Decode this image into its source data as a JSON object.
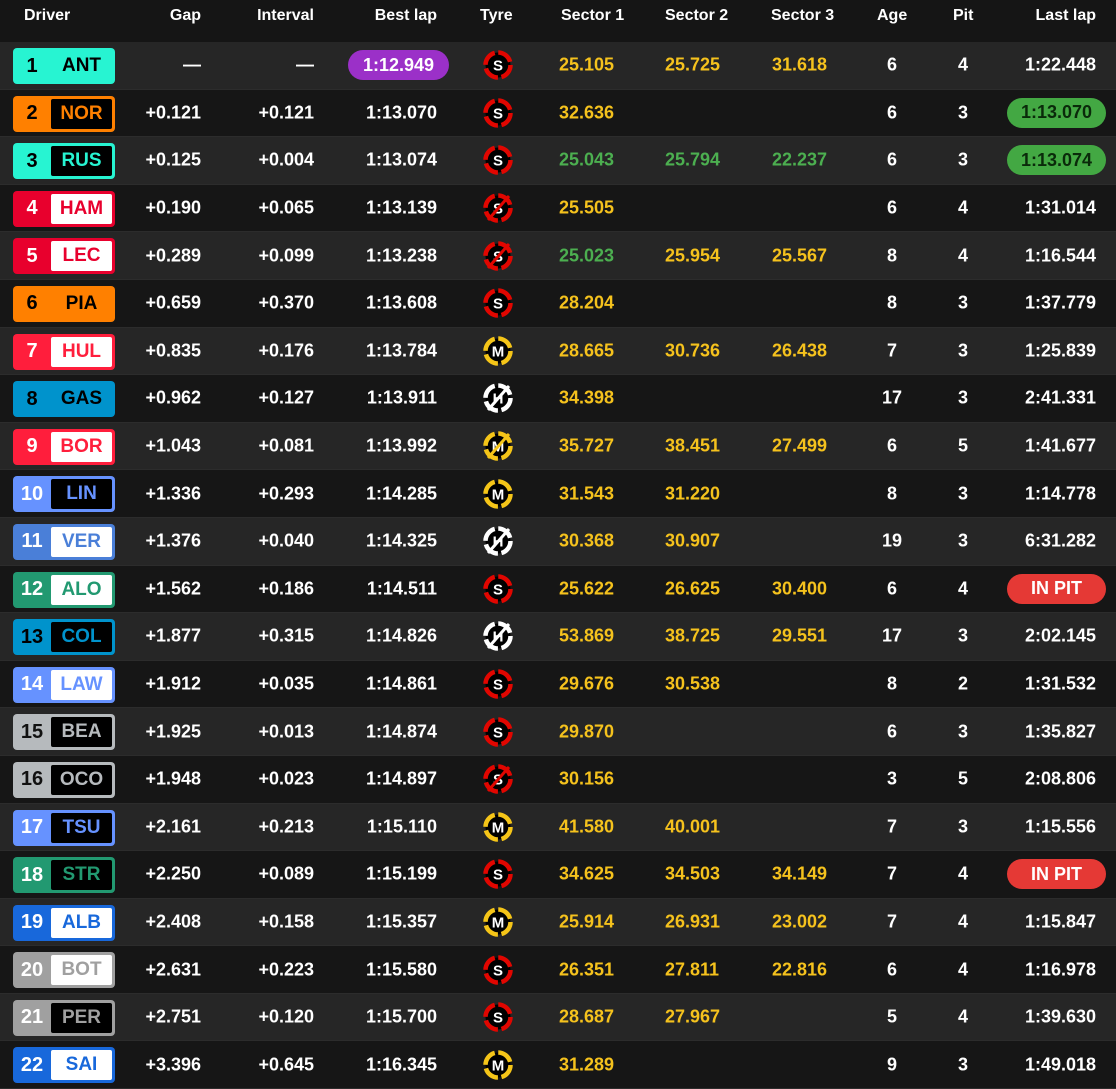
{
  "headers": {
    "driver": "Driver",
    "gap": "Gap",
    "interval": "Interval",
    "best_lap": "Best lap",
    "tyre": "Tyre",
    "sector1": "Sector 1",
    "sector2": "Sector 2",
    "sector3": "Sector 3",
    "age": "Age",
    "pit": "Pit",
    "last_lap": "Last lap"
  },
  "colors": {
    "sector_yellow": "#f5c21d",
    "sector_green": "#4caf50",
    "best_purple": "#9b30c8",
    "pill_green": "#43a843",
    "pill_red": "#e53935",
    "soft": "#e10600",
    "medium": "#f5c518",
    "hard": "#ffffff"
  },
  "rows": [
    {
      "pos": "1",
      "code": "ANT",
      "team_color": "#27f4d2",
      "code_bg": "#27f4d2",
      "code_fg": "#000000",
      "gap": "—",
      "interval": "—",
      "best": "1:12.949",
      "best_highlight": "purple",
      "tyre": "S",
      "tyre_icon": "soft-tyre-icon",
      "tyre_used": false,
      "s1": "25.105",
      "s1c": "yellow",
      "s2": "25.725",
      "s2c": "yellow",
      "s3": "31.618",
      "s3c": "yellow",
      "age": "6",
      "pit": "4",
      "last": "1:22.448",
      "last_style": "plain"
    },
    {
      "pos": "2",
      "code": "NOR",
      "team_color": "#ff8000",
      "code_bg": "#000000",
      "code_fg": "#ff8000",
      "gap": "+0.121",
      "interval": "+0.121",
      "best": "1:13.070",
      "best_highlight": "",
      "tyre": "S",
      "tyre_icon": "soft-tyre-icon",
      "tyre_used": false,
      "s1": "32.636",
      "s1c": "yellow",
      "s2": "",
      "s2c": "",
      "s3": "",
      "s3c": "",
      "age": "6",
      "pit": "3",
      "last": "1:13.070",
      "last_style": "green"
    },
    {
      "pos": "3",
      "code": "RUS",
      "team_color": "#27f4d2",
      "code_bg": "#000000",
      "code_fg": "#27f4d2",
      "gap": "+0.125",
      "interval": "+0.004",
      "best": "1:13.074",
      "best_highlight": "",
      "tyre": "S",
      "tyre_icon": "soft-tyre-icon",
      "tyre_used": false,
      "s1": "25.043",
      "s1c": "green",
      "s2": "25.794",
      "s2c": "green",
      "s3": "22.237",
      "s3c": "green",
      "age": "6",
      "pit": "3",
      "last": "1:13.074",
      "last_style": "green"
    },
    {
      "pos": "4",
      "code": "HAM",
      "team_color": "#e8002d",
      "code_bg": "#ffffff",
      "code_fg": "#e8002d",
      "gap": "+0.190",
      "interval": "+0.065",
      "best": "1:13.139",
      "best_highlight": "",
      "tyre": "S",
      "tyre_icon": "soft-tyre-icon",
      "tyre_used": true,
      "s1": "25.505",
      "s1c": "yellow",
      "s2": "",
      "s2c": "",
      "s3": "",
      "s3c": "",
      "age": "6",
      "pit": "4",
      "last": "1:31.014",
      "last_style": "plain"
    },
    {
      "pos": "5",
      "code": "LEC",
      "team_color": "#e8002d",
      "code_bg": "#ffffff",
      "code_fg": "#e8002d",
      "gap": "+0.289",
      "interval": "+0.099",
      "best": "1:13.238",
      "best_highlight": "",
      "tyre": "S",
      "tyre_icon": "soft-tyre-icon",
      "tyre_used": true,
      "s1": "25.023",
      "s1c": "green",
      "s2": "25.954",
      "s2c": "yellow",
      "s3": "25.567",
      "s3c": "yellow",
      "age": "8",
      "pit": "4",
      "last": "1:16.544",
      "last_style": "plain"
    },
    {
      "pos": "6",
      "code": "PIA",
      "team_color": "#ff8000",
      "code_bg": "#ff8000",
      "code_fg": "#000000",
      "gap": "+0.659",
      "interval": "+0.370",
      "best": "1:13.608",
      "best_highlight": "",
      "tyre": "S",
      "tyre_icon": "soft-tyre-icon",
      "tyre_used": false,
      "s1": "28.204",
      "s1c": "yellow",
      "s2": "",
      "s2c": "",
      "s3": "",
      "s3c": "",
      "age": "8",
      "pit": "3",
      "last": "1:37.779",
      "last_style": "plain"
    },
    {
      "pos": "7",
      "code": "HUL",
      "team_color": "#ff1e3c",
      "code_bg": "#ffffff",
      "code_fg": "#ff1e3c",
      "gap": "+0.835",
      "interval": "+0.176",
      "best": "1:13.784",
      "best_highlight": "",
      "tyre": "M",
      "tyre_icon": "medium-tyre-icon",
      "tyre_used": false,
      "s1": "28.665",
      "s1c": "yellow",
      "s2": "30.736",
      "s2c": "yellow",
      "s3": "26.438",
      "s3c": "yellow",
      "age": "7",
      "pit": "3",
      "last": "1:25.839",
      "last_style": "plain"
    },
    {
      "pos": "8",
      "code": "GAS",
      "team_color": "#0093cc",
      "code_bg": "#0093cc",
      "code_fg": "#000000",
      "gap": "+0.962",
      "interval": "+0.127",
      "best": "1:13.911",
      "best_highlight": "",
      "tyre": "H",
      "tyre_icon": "hard-tyre-icon",
      "tyre_used": true,
      "s1": "34.398",
      "s1c": "yellow",
      "s2": "",
      "s2c": "",
      "s3": "",
      "s3c": "",
      "age": "17",
      "pit": "3",
      "last": "2:41.331",
      "last_style": "plain"
    },
    {
      "pos": "9",
      "code": "BOR",
      "team_color": "#ff1e3c",
      "code_bg": "#ffffff",
      "code_fg": "#ff1e3c",
      "gap": "+1.043",
      "interval": "+0.081",
      "best": "1:13.992",
      "best_highlight": "",
      "tyre": "M",
      "tyre_icon": "medium-tyre-icon",
      "tyre_used": true,
      "s1": "35.727",
      "s1c": "yellow",
      "s2": "38.451",
      "s2c": "yellow",
      "s3": "27.499",
      "s3c": "yellow",
      "age": "6",
      "pit": "5",
      "last": "1:41.677",
      "last_style": "plain"
    },
    {
      "pos": "10",
      "code": "LIN",
      "team_color": "#6692ff",
      "code_bg": "#000000",
      "code_fg": "#6692ff",
      "gap": "+1.336",
      "interval": "+0.293",
      "best": "1:14.285",
      "best_highlight": "",
      "tyre": "M",
      "tyre_icon": "medium-tyre-icon",
      "tyre_used": false,
      "s1": "31.543",
      "s1c": "yellow",
      "s2": "31.220",
      "s2c": "yellow",
      "s3": "",
      "s3c": "",
      "age": "8",
      "pit": "3",
      "last": "1:14.778",
      "last_style": "plain"
    },
    {
      "pos": "11",
      "code": "VER",
      "team_color": "#4a7fd8",
      "code_bg": "#ffffff",
      "code_fg": "#4a7fd8",
      "gap": "+1.376",
      "interval": "+0.040",
      "best": "1:14.325",
      "best_highlight": "",
      "tyre": "H",
      "tyre_icon": "hard-tyre-icon",
      "tyre_used": true,
      "s1": "30.368",
      "s1c": "yellow",
      "s2": "30.907",
      "s2c": "yellow",
      "s3": "",
      "s3c": "",
      "age": "19",
      "pit": "3",
      "last": "6:31.282",
      "last_style": "plain"
    },
    {
      "pos": "12",
      "code": "ALO",
      "team_color": "#229971",
      "code_bg": "#ffffff",
      "code_fg": "#229971",
      "gap": "+1.562",
      "interval": "+0.186",
      "best": "1:14.511",
      "best_highlight": "",
      "tyre": "S",
      "tyre_icon": "soft-tyre-icon",
      "tyre_used": false,
      "s1": "25.622",
      "s1c": "yellow",
      "s2": "26.625",
      "s2c": "yellow",
      "s3": "30.400",
      "s3c": "yellow",
      "age": "6",
      "pit": "4",
      "last": "IN PIT",
      "last_style": "red"
    },
    {
      "pos": "13",
      "code": "COL",
      "team_color": "#0093cc",
      "code_bg": "#000000",
      "code_fg": "#0093cc",
      "gap": "+1.877",
      "interval": "+0.315",
      "best": "1:14.826",
      "best_highlight": "",
      "tyre": "H",
      "tyre_icon": "hard-tyre-icon",
      "tyre_used": true,
      "s1": "53.869",
      "s1c": "yellow",
      "s2": "38.725",
      "s2c": "yellow",
      "s3": "29.551",
      "s3c": "yellow",
      "age": "17",
      "pit": "3",
      "last": "2:02.145",
      "last_style": "plain"
    },
    {
      "pos": "14",
      "code": "LAW",
      "team_color": "#6692ff",
      "code_bg": "#ffffff",
      "code_fg": "#6692ff",
      "gap": "+1.912",
      "interval": "+0.035",
      "best": "1:14.861",
      "best_highlight": "",
      "tyre": "S",
      "tyre_icon": "soft-tyre-icon",
      "tyre_used": false,
      "s1": "29.676",
      "s1c": "yellow",
      "s2": "30.538",
      "s2c": "yellow",
      "s3": "",
      "s3c": "",
      "age": "8",
      "pit": "2",
      "last": "1:31.532",
      "last_style": "plain"
    },
    {
      "pos": "15",
      "code": "BEA",
      "team_color": "#b6babd",
      "code_bg": "#000000",
      "code_fg": "#b6babd",
      "gap": "+1.925",
      "interval": "+0.013",
      "best": "1:14.874",
      "best_highlight": "",
      "tyre": "S",
      "tyre_icon": "soft-tyre-icon",
      "tyre_used": false,
      "s1": "29.870",
      "s1c": "yellow",
      "s2": "",
      "s2c": "",
      "s3": "",
      "s3c": "",
      "age": "6",
      "pit": "3",
      "last": "1:35.827",
      "last_style": "plain"
    },
    {
      "pos": "16",
      "code": "OCO",
      "team_color": "#b6babd",
      "code_bg": "#000000",
      "code_fg": "#b6babd",
      "gap": "+1.948",
      "interval": "+0.023",
      "best": "1:14.897",
      "best_highlight": "",
      "tyre": "S",
      "tyre_icon": "soft-tyre-icon",
      "tyre_used": true,
      "s1": "30.156",
      "s1c": "yellow",
      "s2": "",
      "s2c": "",
      "s3": "",
      "s3c": "",
      "age": "3",
      "pit": "5",
      "last": "2:08.806",
      "last_style": "plain"
    },
    {
      "pos": "17",
      "code": "TSU",
      "team_color": "#6692ff",
      "code_bg": "#000000",
      "code_fg": "#6692ff",
      "gap": "+2.161",
      "interval": "+0.213",
      "best": "1:15.110",
      "best_highlight": "",
      "tyre": "M",
      "tyre_icon": "medium-tyre-icon",
      "tyre_used": false,
      "s1": "41.580",
      "s1c": "yellow",
      "s2": "40.001",
      "s2c": "yellow",
      "s3": "",
      "s3c": "",
      "age": "7",
      "pit": "3",
      "last": "1:15.556",
      "last_style": "plain"
    },
    {
      "pos": "18",
      "code": "STR",
      "team_color": "#229971",
      "code_bg": "#000000",
      "code_fg": "#229971",
      "gap": "+2.250",
      "interval": "+0.089",
      "best": "1:15.199",
      "best_highlight": "",
      "tyre": "S",
      "tyre_icon": "soft-tyre-icon",
      "tyre_used": false,
      "s1": "34.625",
      "s1c": "yellow",
      "s2": "34.503",
      "s2c": "yellow",
      "s3": "34.149",
      "s3c": "yellow",
      "age": "7",
      "pit": "4",
      "last": "IN PIT",
      "last_style": "red"
    },
    {
      "pos": "19",
      "code": "ALB",
      "team_color": "#1868db",
      "code_bg": "#ffffff",
      "code_fg": "#1868db",
      "gap": "+2.408",
      "interval": "+0.158",
      "best": "1:15.357",
      "best_highlight": "",
      "tyre": "M",
      "tyre_icon": "medium-tyre-icon",
      "tyre_used": false,
      "s1": "25.914",
      "s1c": "yellow",
      "s2": "26.931",
      "s2c": "yellow",
      "s3": "23.002",
      "s3c": "yellow",
      "age": "7",
      "pit": "4",
      "last": "1:15.847",
      "last_style": "plain"
    },
    {
      "pos": "20",
      "code": "BOT",
      "team_color": "#a0a0a0",
      "code_bg": "#ffffff",
      "code_fg": "#a0a0a0",
      "gap": "+2.631",
      "interval": "+0.223",
      "best": "1:15.580",
      "best_highlight": "",
      "tyre": "S",
      "tyre_icon": "soft-tyre-icon",
      "tyre_used": false,
      "s1": "26.351",
      "s1c": "yellow",
      "s2": "27.811",
      "s2c": "yellow",
      "s3": "22.816",
      "s3c": "yellow",
      "age": "6",
      "pit": "4",
      "last": "1:16.978",
      "last_style": "plain"
    },
    {
      "pos": "21",
      "code": "PER",
      "team_color": "#a0a0a0",
      "code_bg": "#000000",
      "code_fg": "#a0a0a0",
      "gap": "+2.751",
      "interval": "+0.120",
      "best": "1:15.700",
      "best_highlight": "",
      "tyre": "S",
      "tyre_icon": "soft-tyre-icon",
      "tyre_used": false,
      "s1": "28.687",
      "s1c": "yellow",
      "s2": "27.967",
      "s2c": "yellow",
      "s3": "",
      "s3c": "",
      "age": "5",
      "pit": "4",
      "last": "1:39.630",
      "last_style": "plain"
    },
    {
      "pos": "22",
      "code": "SAI",
      "team_color": "#1868db",
      "code_bg": "#ffffff",
      "code_fg": "#1868db",
      "gap": "+3.396",
      "interval": "+0.645",
      "best": "1:16.345",
      "best_highlight": "",
      "tyre": "M",
      "tyre_icon": "medium-tyre-icon",
      "tyre_used": false,
      "s1": "31.289",
      "s1c": "yellow",
      "s2": "",
      "s2c": "",
      "s3": "",
      "s3c": "",
      "age": "9",
      "pit": "3",
      "last": "1:49.018",
      "last_style": "plain"
    }
  ]
}
